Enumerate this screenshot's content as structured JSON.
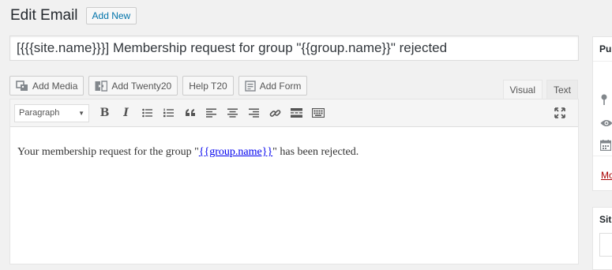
{
  "header": {
    "title": "Edit Email",
    "add_new_label": "Add New"
  },
  "post_title": {
    "value": "[{{{site.name}}}] Membership request for group \"{{group.name}}\" rejected"
  },
  "media_buttons": [
    {
      "label": "Add Media",
      "icon": "media-icon"
    },
    {
      "label": "Add Twenty20",
      "icon": "twenty20-icon"
    },
    {
      "label": "Help T20",
      "icon": null
    },
    {
      "label": "Add Form",
      "icon": "form-icon"
    }
  ],
  "editor_tabs": [
    {
      "label": "Visual",
      "active": true
    },
    {
      "label": "Text",
      "active": false
    }
  ],
  "toolbar": {
    "format_value": "Paragraph",
    "bold_glyph": "B",
    "italic_glyph": "I"
  },
  "content": {
    "text_before": "Your membership request for the group \"",
    "link_text": "{{group.name}}",
    "text_after": "\" has been rejected."
  },
  "sidebar": {
    "publish_box_title": "Pu",
    "move_link": "Mo",
    "second_box_title": "Sit"
  },
  "colors": {
    "background": "#f1f1f1",
    "link": "#0073aa",
    "trash_link": "#a00"
  }
}
